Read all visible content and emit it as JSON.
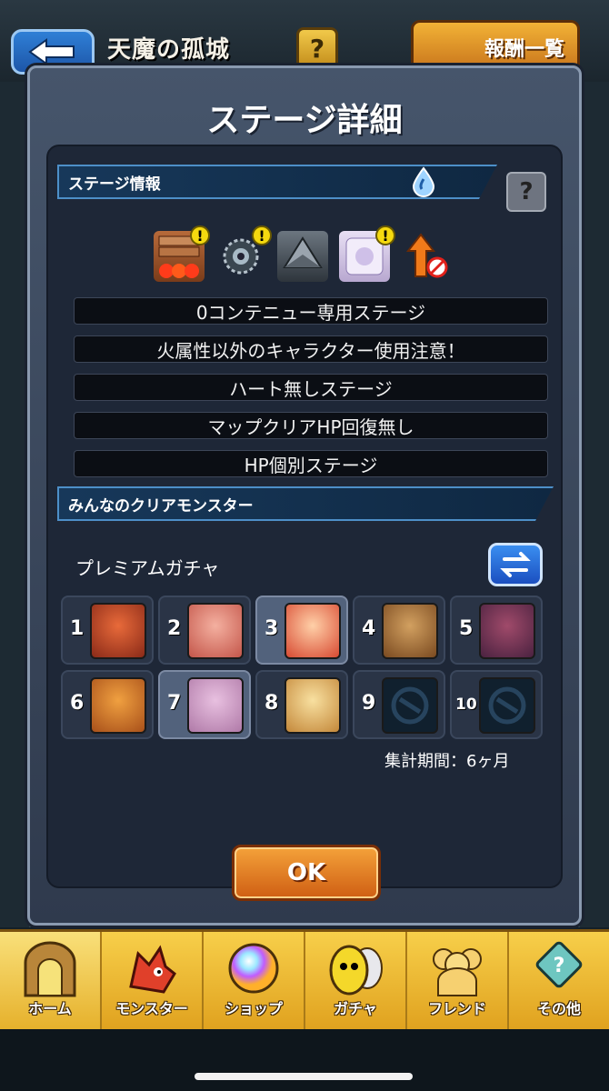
{
  "topbar": {
    "title": "天魔の孤城",
    "help_label": "?",
    "reward_label": "報酬一覧"
  },
  "dialog": {
    "title": "ステージ詳細",
    "info_header": "ステージ情報",
    "help_label": "?",
    "element_icon": "water-drop-icon",
    "gimmick_icons": [
      "block-wall-icon",
      "mine-icon",
      "crusher-icon",
      "panel-icon",
      "no-speed-up-icon"
    ],
    "warning_mark": "!",
    "rules": [
      "0コンテニュー専用ステージ",
      "火属性以外のキャラクター使用注意！",
      "ハート無しステージ",
      "マップクリアHP回復無し",
      "HP個別ステージ"
    ],
    "clear_header": "みんなのクリアモンスター",
    "gacha_label": "プレミアムガチャ",
    "swap_icon": "swap-arrows-icon",
    "ranking": [
      {
        "rank": "1",
        "highlight": false,
        "color": "#8a2a18"
      },
      {
        "rank": "2",
        "highlight": false,
        "color": "#c4564a"
      },
      {
        "rank": "3",
        "highlight": true,
        "color": "#d84a32"
      },
      {
        "rank": "4",
        "highlight": false,
        "color": "#7a4a20"
      },
      {
        "rank": "5",
        "highlight": false,
        "color": "#4a2240"
      },
      {
        "rank": "6",
        "highlight": false,
        "color": "#a8501a"
      },
      {
        "rank": "7",
        "highlight": true,
        "color": "#b07aa8"
      },
      {
        "rank": "8",
        "highlight": false,
        "color": "#c4883a"
      },
      {
        "rank": "9",
        "highlight": false,
        "color": "#10202e"
      },
      {
        "rank": "10",
        "highlight": false,
        "color": "#10202e"
      }
    ],
    "period": "集計期間：6ヶ月",
    "ok_label": "OK"
  },
  "bottom_nav": [
    {
      "label": "ホーム",
      "icon": "home-gate-icon",
      "active": true
    },
    {
      "label": "モンスター",
      "icon": "dragon-icon",
      "active": false
    },
    {
      "label": "ショップ",
      "icon": "orb-icon",
      "active": false
    },
    {
      "label": "ガチャ",
      "icon": "egg-icon",
      "active": false
    },
    {
      "label": "フレンド",
      "icon": "friends-icon",
      "active": false
    },
    {
      "label": "その他",
      "icon": "menu-box-icon",
      "active": false
    }
  ],
  "colors": {
    "accent_blue": "#4d8fc8",
    "ok_orange": "#e07a22",
    "nav_gold": "#f0c03a"
  }
}
